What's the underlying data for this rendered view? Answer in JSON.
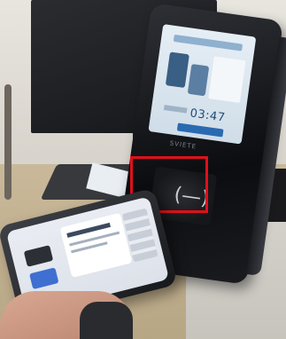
{
  "scene": {
    "description_free": true,
    "reader": {
      "brand_text": "SVIETE",
      "screen_time": "03:47",
      "nfc_symbol": "(—)"
    },
    "highlight": {
      "color": "#e0101a"
    }
  }
}
